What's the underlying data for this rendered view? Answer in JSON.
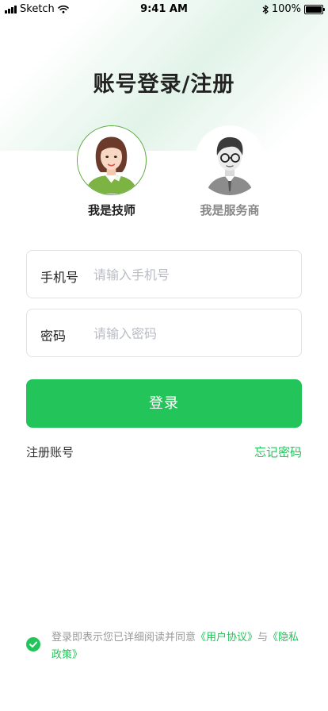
{
  "status_bar": {
    "carrier": "Sketch",
    "time": "9:41 AM",
    "battery": "100%",
    "battery_level": 1.0
  },
  "page": {
    "title": "账号登录/注册"
  },
  "roles": [
    {
      "label": "我是技师",
      "selected": true,
      "icon": "female-technician-avatar"
    },
    {
      "label": "我是服务商",
      "selected": false,
      "icon": "male-provider-avatar"
    }
  ],
  "form": {
    "phone": {
      "label": "手机号",
      "placeholder": "请输入手机号",
      "value": ""
    },
    "password": {
      "label": "密码",
      "placeholder": "请输入密码",
      "value": ""
    }
  },
  "actions": {
    "login": "登录",
    "register": "注册账号",
    "forgot": "忘记密码"
  },
  "agreement": {
    "checked": true,
    "prefix": "登录即表示您已详细阅读并同意",
    "user_agreement": "《用户协议》",
    "conjunction": "与",
    "privacy_policy": "《隐私政策》"
  },
  "colors": {
    "accent": "#23c45a",
    "selected_ring": "#5aa83a",
    "placeholder": "#b9bcc4"
  }
}
